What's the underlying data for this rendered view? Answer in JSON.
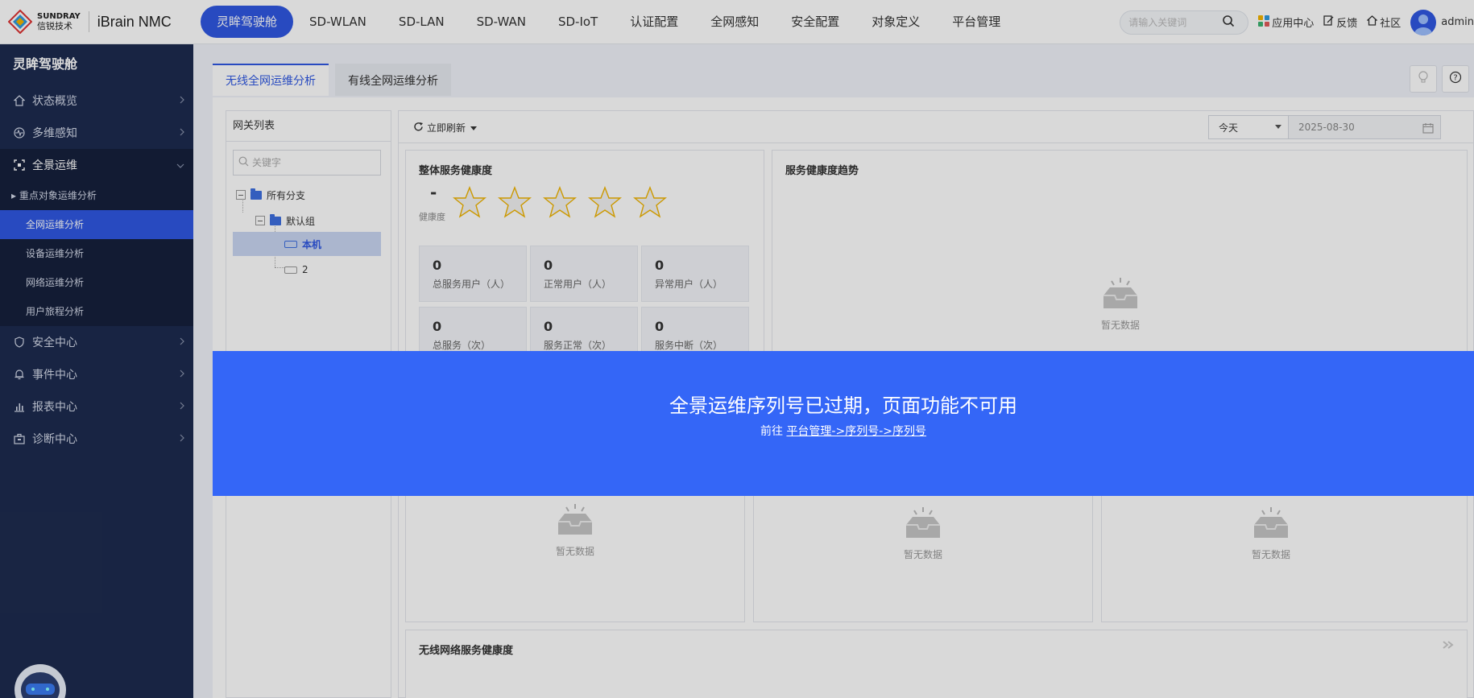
{
  "logo": {
    "brand_en": "SUNDRAY",
    "brand_cn": "信锐技术",
    "product": "iBrain NMC"
  },
  "nav": [
    {
      "label": "灵眸驾驶舱",
      "active": true
    },
    {
      "label": "SD-WLAN"
    },
    {
      "label": "SD-LAN"
    },
    {
      "label": "SD-WAN"
    },
    {
      "label": "SD-IoT"
    },
    {
      "label": "认证配置"
    },
    {
      "label": "全网感知"
    },
    {
      "label": "安全配置"
    },
    {
      "label": "对象定义"
    },
    {
      "label": "平台管理"
    }
  ],
  "top_right": {
    "search_placeholder": "请输入关键词",
    "app_center": "应用中心",
    "feedback": "反馈",
    "community": "社区",
    "user": "admin"
  },
  "sidebar": {
    "title": "灵眸驾驶舱",
    "items": [
      {
        "label": "状态概览",
        "icon": "home-icon"
      },
      {
        "label": "多维感知",
        "icon": "pulse-icon"
      },
      {
        "label": "全景运维",
        "icon": "scan-icon",
        "open": true
      },
      {
        "label": "安全中心",
        "icon": "shield-icon"
      },
      {
        "label": "事件中心",
        "icon": "bell-icon"
      },
      {
        "label": "报表中心",
        "icon": "bar-chart-icon"
      },
      {
        "label": "诊断中心",
        "icon": "briefcase-icon"
      }
    ],
    "sub_items": [
      {
        "label": "重点对象运维分析",
        "group": true
      },
      {
        "label": "全网运维分析",
        "active": true
      },
      {
        "label": "设备运维分析"
      },
      {
        "label": "网络运维分析"
      },
      {
        "label": "用户旅程分析"
      }
    ]
  },
  "tabs": [
    {
      "label": "无线全网运维分析",
      "active": true
    },
    {
      "label": "有线全网运维分析"
    }
  ],
  "gateway_list": {
    "title": "网关列表",
    "search_placeholder": "关键字",
    "tree": {
      "root": "所有分支",
      "group": "默认组",
      "devices": [
        "本机",
        "2"
      ]
    }
  },
  "toolbar": {
    "refresh_label": "立即刷新",
    "period": "今天",
    "date": "2025-08-30"
  },
  "overall_health": {
    "title": "整体服务健康度",
    "score": "-",
    "score_label": "健康度",
    "stars_total": 5,
    "metrics": [
      {
        "value": "0",
        "label": "总服务用户（人）"
      },
      {
        "value": "0",
        "label": "正常用户（人）"
      },
      {
        "value": "0",
        "label": "异常用户（人）"
      },
      {
        "value": "0",
        "label": "总服务（次）"
      },
      {
        "value": "0",
        "label": "服务正常（次）"
      },
      {
        "value": "0",
        "label": "服务中断（次）"
      }
    ]
  },
  "trend": {
    "title": "服务健康度趋势"
  },
  "no_data": "暂无数据",
  "wireless_health": {
    "title": "无线网络服务健康度"
  },
  "banner": {
    "title": "全景运维序列号已过期，页面功能不可用",
    "prefix": "前往",
    "link": "平台管理->序列号->序列号"
  },
  "colors": {
    "accent": "#2f58e2",
    "banner": "#3466f7",
    "sidebar": "#1d2b4f"
  }
}
